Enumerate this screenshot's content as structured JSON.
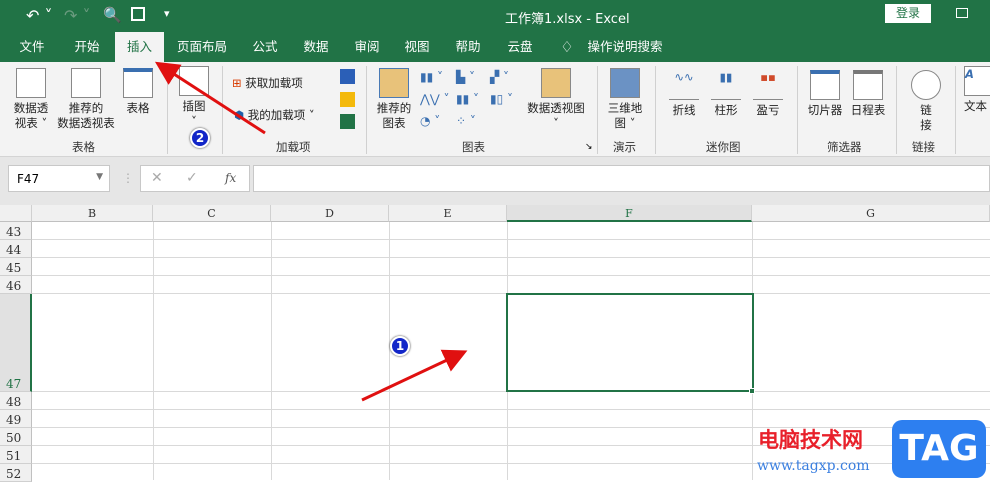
{
  "title": "工作簿1.xlsx  -  Excel",
  "login": "登录",
  "tabs": [
    "文件",
    "开始",
    "插入",
    "页面布局",
    "公式",
    "数据",
    "审阅",
    "视图",
    "帮助",
    "云盘"
  ],
  "search": "操作说明搜索",
  "ribbon": {
    "pivot": [
      "数据透",
      "视表 ˅"
    ],
    "rec_pivot": [
      "推荐的",
      "数据透视表"
    ],
    "table": "表格",
    "group_table": "表格",
    "illus": [
      "插图",
      "˅"
    ],
    "get_addins": "获取加载项",
    "my_addins": "我的加载项",
    "group_addins": "加载项",
    "rec_chart": [
      "推荐的",
      "图表"
    ],
    "pivot_chart": [
      "数据透视图",
      "˅"
    ],
    "group_charts": "图表",
    "map3d": [
      "三维地",
      "图 ˅"
    ],
    "group_tours": "演示",
    "line": "折线",
    "column": "柱形",
    "winloss": "盈亏",
    "group_spark": "迷你图",
    "slicer": "切片器",
    "timeline": "日程表",
    "group_filter": "筛选器",
    "link": [
      "链",
      "接"
    ],
    "group_links": "链接",
    "text": "文本"
  },
  "namebox": "F47",
  "formula": "",
  "columns": [
    "B",
    "C",
    "D",
    "E",
    "F",
    "G"
  ],
  "rows": [
    "43",
    "44",
    "45",
    "46",
    "47",
    "48",
    "49",
    "50",
    "51",
    "52"
  ],
  "selected_cell": "F47",
  "badges": [
    "1",
    "2"
  ],
  "watermark": {
    "site": "电脑技术网",
    "url": "www.tagxp.com",
    "logo": "TAG"
  },
  "colors": {
    "accent": "#217346",
    "arrow": "#e01010",
    "badge": "#1226c8"
  }
}
